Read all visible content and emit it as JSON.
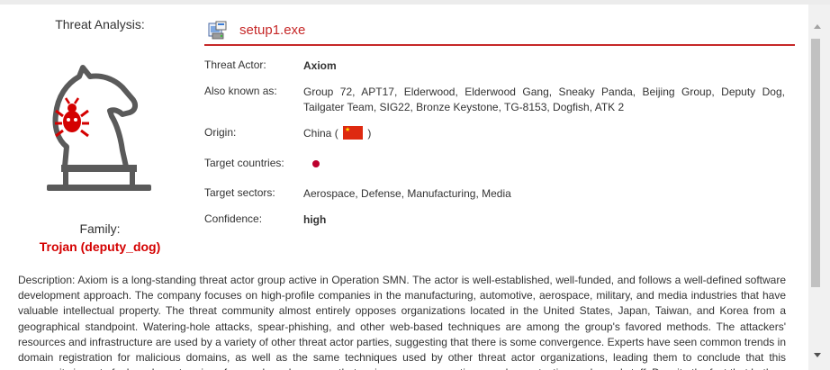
{
  "left": {
    "threat_analysis_label": "Threat Analysis:",
    "family_label": "Family:",
    "family_value": "Trojan (deputy_dog)",
    "icon": "chess-knight-with-bug-icon",
    "bug_color": "#d40000"
  },
  "file": {
    "icon": "installer-exe-icon",
    "name": "setup1.exe",
    "accent_color": "#c62828"
  },
  "details": {
    "threat_actor_label": "Threat Actor:",
    "threat_actor_value": "Axiom",
    "aka_label": "Also known as:",
    "aka_value": "Group 72, APT17, Elderwood, Elderwood Gang, Sneaky Panda, Beijing Group, Deputy Dog, Tailgater Team, SIG22, Bronze Keystone, TG-8153, Dogfish, ATK 2",
    "origin_label": "Origin:",
    "origin_prefix": "China (",
    "origin_suffix": ")",
    "origin_flag": "china-flag-icon",
    "target_countries_label": "Target countries:",
    "target_countries_flag": "japan-flag-dot-icon",
    "target_sectors_label": "Target sectors:",
    "target_sectors_value": "Aerospace, Defense, Manufacturing, Media",
    "confidence_label": "Confidence:",
    "confidence_value": "high"
  },
  "description": "Description: Axiom is a long-standing threat actor group active in Operation SMN. The actor is well-established, well-funded, and follows a well-defined software development approach. The company focuses on high-profile companies in the manufacturing, automotive, aerospace, military, and media industries that have valuable intellectual property. The threat community almost entirely opposes organizations located in the United States, Japan, Taiwan, and Korea from a geographical standpoint. Watering-hole attacks, spear-phishing, and other web-based techniques are among the group's favored methods. The attackers' resources and infrastructure are used by a variety of other threat actor parties, suggesting that there is some convergence. Experts have seen common trends in domain registration for malicious domains, as well as the same techniques used by other threat actor organizations, leading them to conclude that this community is part of a broader enterprise of several employees, or that various groups sometimes exchange tactics, code, and staff. Despite the fact that both"
}
